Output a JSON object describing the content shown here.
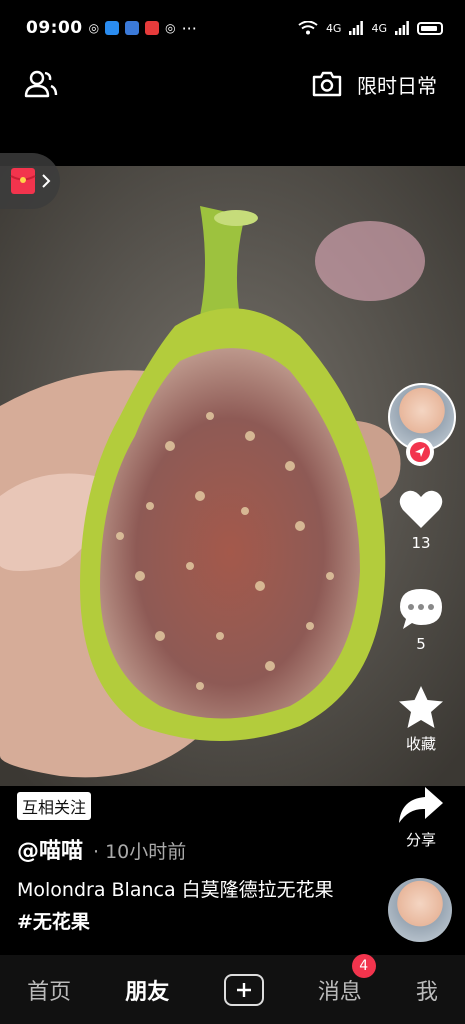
{
  "status_bar": {
    "time": "09:00",
    "signal_label_1": "4G",
    "signal_label_2": "4G",
    "dots": "···"
  },
  "header": {
    "title": "限时日常"
  },
  "actions": {
    "likes": "13",
    "comments": "5",
    "favorite_label": "收藏",
    "share_label": "分享"
  },
  "post": {
    "follow_tag": "互相关注",
    "author": "@喵喵",
    "separator": "·",
    "time_ago": "10小时前",
    "caption_text": "Molondra Blanca 白莫隆德拉无花果",
    "hashtag": "#无花果"
  },
  "nav": {
    "home": "首页",
    "friends": "朋友",
    "messages": "消息",
    "messages_badge": "4",
    "me": "我"
  },
  "colors": {
    "accent_red": "#f2344d",
    "fig_green": "#a9c43a",
    "fig_flesh": "#9b5c4f"
  }
}
